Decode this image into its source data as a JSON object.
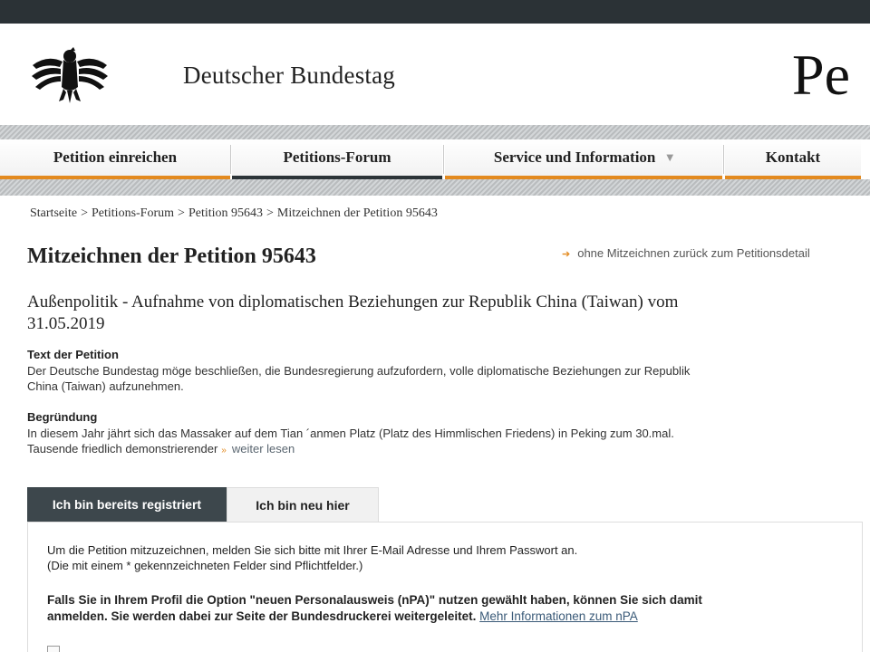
{
  "header": {
    "site_name": "Deutscher Bundestag",
    "cropped_title": "Pe"
  },
  "nav": [
    {
      "label": "Petition einreichen"
    },
    {
      "label": "Petitions-Forum",
      "active": true
    },
    {
      "label": "Service und Information",
      "has_dropdown": true
    },
    {
      "label": "Kontakt"
    }
  ],
  "breadcrumb": {
    "items": [
      "Startseite",
      "Petitions-Forum",
      "Petition 95643",
      "Mitzeichnen der Petition 95643"
    ],
    "separator": ">"
  },
  "page": {
    "title": "Mitzeichnen der Petition 95643",
    "back_link": "ohne Mitzeichnen zurück zum Petitionsdetail",
    "subject_line1": "Außenpolitik - Aufnahme von diplomatischen Beziehungen zur Republik China (Taiwan) vom",
    "subject_line2": "31.05.2019"
  },
  "petition_text": {
    "label": "Text der Petition",
    "line1": "Der Deutsche Bundestag möge beschließen, die Bundesregierung aufzufordern, volle diplomatische Beziehungen zur Republik",
    "line2": "China (Taiwan) aufzunehmen."
  },
  "reasoning": {
    "label": "Begründung",
    "line1": "In diesem Jahr jährt sich das Massaker auf dem Tian ´anmen Platz (Platz des Himmlischen Friedens) in Peking zum 30.mal.",
    "line2": "Tausende friedlich demonstrierender",
    "more_link": "weiter lesen"
  },
  "tabs": [
    {
      "label": "Ich bin bereits registriert",
      "active": true
    },
    {
      "label": "Ich bin neu hier",
      "active": false
    }
  ],
  "login_panel": {
    "instruction1": "Um die Petition mitzuzeichnen, melden Sie sich bitte mit Ihrer E-Mail Adresse und Ihrem Passwort an.",
    "instruction2": "(Die mit einem * gekennzeichneten Felder sind Pflichtfelder.)",
    "npa_line1": "Falls Sie in Ihrem Profil die Option \"neuen Personalausweis (nPA)\" nutzen gewählt haben, können Sie sich damit",
    "npa_line2": "anmelden. Sie werden dabei zur Seite der Bundesdruckerei weitergeleitet.",
    "npa_link": "Mehr Informationen zum nPA"
  },
  "icons": {
    "logo": "bundestag-eagle",
    "back_arrow": "arrow-right-icon",
    "more": "double-chevron-icon",
    "dropdown": "chevron-down-icon"
  },
  "colors": {
    "accent": "#e38a1f",
    "dark": "#2b3236",
    "tab_active_bg": "#3d474c"
  }
}
